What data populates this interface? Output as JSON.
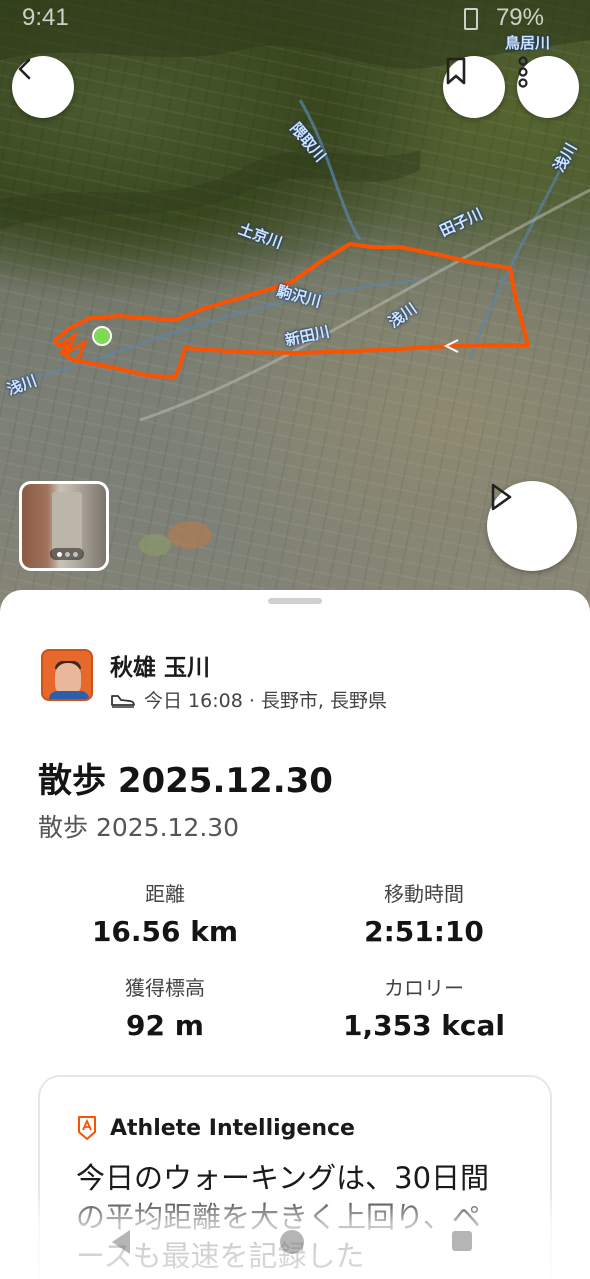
{
  "status_bar": {
    "time": "9:41",
    "battery": "79%"
  },
  "map": {
    "labels": [
      "鳥居川",
      "浅川",
      "田子川",
      "隈取川",
      "土京川",
      "駒沢川",
      "浅川",
      "新田川",
      "浅川"
    ],
    "route_color": "#fc5200",
    "start_marker_color": "#7ed957"
  },
  "icons": {
    "back": "back-arrow-icon",
    "bookmark": "bookmark-icon",
    "more": "more-vertical-icon",
    "play": "play-icon",
    "shoe": "walking-shoe-icon",
    "ai": "athlete-intelligence-icon"
  },
  "athlete": {
    "name": "秋雄 玉川",
    "meta": "今日 16:08 · 長野市, 長野県"
  },
  "activity": {
    "title": "散歩 2025.12.30",
    "description": "散歩 2025.12.30"
  },
  "stats": [
    {
      "label": "距離",
      "value": "16.56 km"
    },
    {
      "label": "移動時間",
      "value": "2:51:10"
    },
    {
      "label": "獲得標高",
      "value": "92 m"
    },
    {
      "label": "カロリー",
      "value": "1,353 kcal"
    }
  ],
  "ai_card": {
    "title": "Athlete Intelligence",
    "text": "今日のウォーキングは、30日間の平均距離を大きく上回り、ペースも最速を記録した"
  }
}
